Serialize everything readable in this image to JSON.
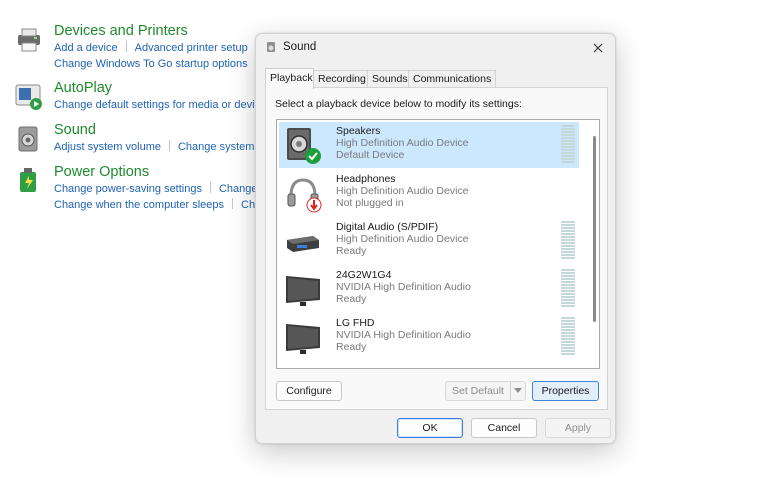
{
  "control_panel": {
    "devices": {
      "title": "Devices and Printers",
      "links_row1": [
        "Add a device",
        "Advanced printer setup"
      ],
      "links_row2": [
        "Change Windows To Go startup options"
      ]
    },
    "autoplay": {
      "title": "AutoPlay",
      "links_row1": [
        "Change default settings for media or devic"
      ]
    },
    "sound": {
      "title": "Sound",
      "links_row1": [
        "Adjust system volume",
        "Change system"
      ]
    },
    "power": {
      "title": "Power Options",
      "links_row1": [
        "Change power-saving settings",
        "Change"
      ],
      "links_row2": [
        "Change when the computer sleeps",
        "Ch"
      ]
    }
  },
  "dialog": {
    "title": "Sound",
    "tabs": [
      "Playback",
      "Recording",
      "Sounds",
      "Communications"
    ],
    "active_tab": "Playback",
    "instruction": "Select a playback device below to modify its settings:",
    "devices": [
      {
        "name": "Speakers",
        "description": "High Definition Audio Device",
        "status": "Default Device",
        "icon": "speaker-icon",
        "badge": "default-check-icon",
        "selected": true
      },
      {
        "name": "Headphones",
        "description": "High Definition Audio Device",
        "status": "Not plugged in",
        "icon": "headphones-icon",
        "badge": "unplugged-arrow-icon",
        "selected": false
      },
      {
        "name": "Digital Audio (S/PDIF)",
        "description": "High Definition Audio Device",
        "status": "Ready",
        "icon": "digital-audio-icon",
        "selected": false
      },
      {
        "name": "24G2W1G4",
        "description": "NVIDIA High Definition Audio",
        "status": "Ready",
        "icon": "monitor-icon",
        "selected": false
      },
      {
        "name": "LG FHD",
        "description": "NVIDIA High Definition Audio",
        "status": "Ready",
        "icon": "monitor-icon",
        "selected": false
      }
    ],
    "buttons": {
      "configure": "Configure",
      "set_default": "Set Default",
      "properties": "Properties",
      "ok": "OK",
      "cancel": "Cancel",
      "apply": "Apply"
    }
  },
  "colors": {
    "link": "#1f63b5",
    "heading": "#1e8a2c",
    "selection": "#cce8ff",
    "check_badge": "#1e9e3c",
    "unplugged_badge": "#d62828"
  }
}
